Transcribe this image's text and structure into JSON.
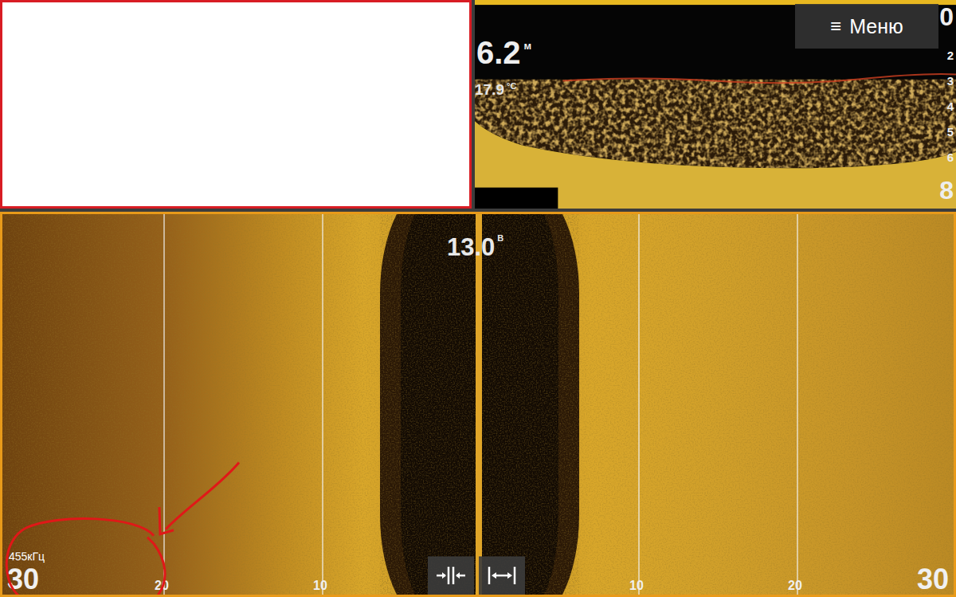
{
  "blank_panel": {
    "highlighted": true
  },
  "down_scan": {
    "depth": "6.2",
    "depth_unit": "м",
    "temperature": "17.9",
    "temperature_unit": "°C",
    "menu": {
      "icon": "≡",
      "label": "Меню"
    },
    "scale": [
      "0",
      "2",
      "3",
      "4",
      "5",
      "6",
      "8"
    ]
  },
  "side_scan": {
    "active": true,
    "voltage": "13.0",
    "voltage_unit": "В",
    "frequency": "455кГц",
    "left_range": [
      "30",
      "20",
      "10"
    ],
    "right_range": [
      "10",
      "20",
      "30"
    ],
    "buttons": [
      {
        "name": "zoom-in"
      },
      {
        "name": "zoom-out"
      }
    ]
  },
  "annotation": {
    "visible": true
  }
}
